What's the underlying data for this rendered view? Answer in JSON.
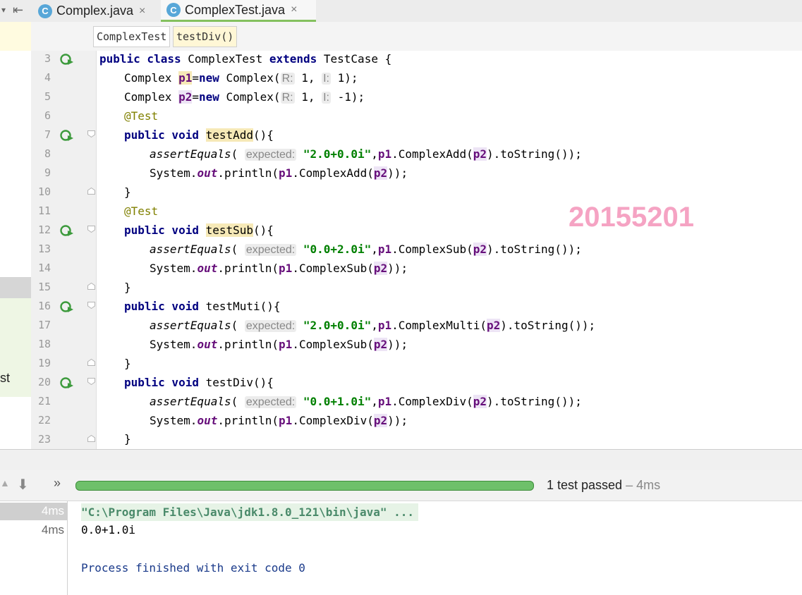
{
  "tabs": [
    {
      "icon": "C",
      "label": "Complex.java",
      "close": "×"
    },
    {
      "icon": "C",
      "label": "ComplexTest.java",
      "close": "×"
    }
  ],
  "breadcrumb": [
    "ComplexTest",
    "testDiv()"
  ],
  "left_fragment": "st",
  "line_numbers": [
    "3",
    "4",
    "5",
    "6",
    "7",
    "8",
    "9",
    "10",
    "11",
    "12",
    "13",
    "14",
    "15",
    "16",
    "17",
    "18",
    "19",
    "20",
    "21",
    "22",
    "23"
  ],
  "code": {
    "l3": {
      "a": "public class ",
      "b": "ComplexTest ",
      "c": "extends ",
      "d": "TestCase {"
    },
    "l4": {
      "pre": "Complex ",
      "f": "p1",
      "eq": "=",
      "kw": "new ",
      "call": "Complex(",
      "h1": "R:",
      "v1": " 1, ",
      "h2": "I:",
      "v2": " 1);"
    },
    "l5": {
      "pre": "Complex ",
      "f": "p2",
      "eq": "=",
      "kw": "new ",
      "call": "Complex(",
      "h1": "R:",
      "v1": " 1, ",
      "h2": "I:",
      "v2": " -1);"
    },
    "l6": "@Test",
    "l7": {
      "kw": "public void ",
      "name": "testAdd",
      "rest": "(){"
    },
    "l8": {
      "m": "assertEquals",
      "o": "( ",
      "hint": "expected:",
      "s": " \"2.0+0.0i\"",
      "c": ",",
      "f": "p1",
      ".": ".ComplexAdd(",
      "f2": "p2",
      "e": ").toString());"
    },
    "l9": {
      "a": "System.",
      "o": "out",
      "b": ".println(",
      "f": "p1",
      "c": ".ComplexAdd(",
      "f2": "p2",
      "e": "));"
    },
    "l10": "}",
    "l11": "@Test",
    "l12": {
      "kw": "public void ",
      "name": "testSub",
      "rest": "(){"
    },
    "l13": {
      "m": "assertEquals",
      "o": "( ",
      "hint": "expected:",
      "s": " \"0.0+2.0i\"",
      "c": ",",
      "f": "p1",
      ".": ".ComplexSub(",
      "f2": "p2",
      "e": ").toString());"
    },
    "l14": {
      "a": "System.",
      "o": "out",
      "b": ".println(",
      "f": "p1",
      "c": ".ComplexSub(",
      "f2": "p2",
      "e": "));"
    },
    "l15": "}",
    "l16": {
      "kw": "public void ",
      "name": "testMuti",
      "rest": "(){"
    },
    "l17": {
      "m": "assertEquals",
      "o": "( ",
      "hint": "expected:",
      "s": " \"2.0+0.0i\"",
      "c": ",",
      "f": "p1",
      ".": ".ComplexMulti(",
      "f2": "p2",
      "e": ").toString());"
    },
    "l18": {
      "a": "System.",
      "o": "out",
      "b": ".println(",
      "f": "p1",
      "c": ".ComplexSub(",
      "f2": "p2",
      "e": "));"
    },
    "l19": "}",
    "l20": {
      "kw": "public void ",
      "name": "testDiv",
      "rest": "(){"
    },
    "l21": {
      "m": "assertEquals",
      "o": "( ",
      "hint": "expected:",
      "s": " \"0.0+1.0i\"",
      "c": ",",
      "f": "p1",
      ".": ".ComplexDiv(",
      "f2": "p2",
      "e": ").toString());"
    },
    "l22": {
      "a": "System.",
      "o": "out",
      "b": ".println(",
      "f": "p1",
      "c": ".ComplexDiv(",
      "f2": "p2",
      "e": "));"
    },
    "l23": "}"
  },
  "watermark": "20155201",
  "run": {
    "chevron": "»",
    "status_main": "1 test passed",
    "status_time": " – 4ms",
    "progress_fraction": 1.0,
    "durations": [
      "4ms",
      "4ms"
    ]
  },
  "output": [
    "\"C:\\Program Files\\Java\\jdk1.8.0_121\\bin\\java\" ...",
    "0.0+1.0i",
    "Process finished with exit code 0"
  ],
  "colors": {
    "accent_green": "#6ec06a",
    "watermark": "#f5a3c3"
  }
}
